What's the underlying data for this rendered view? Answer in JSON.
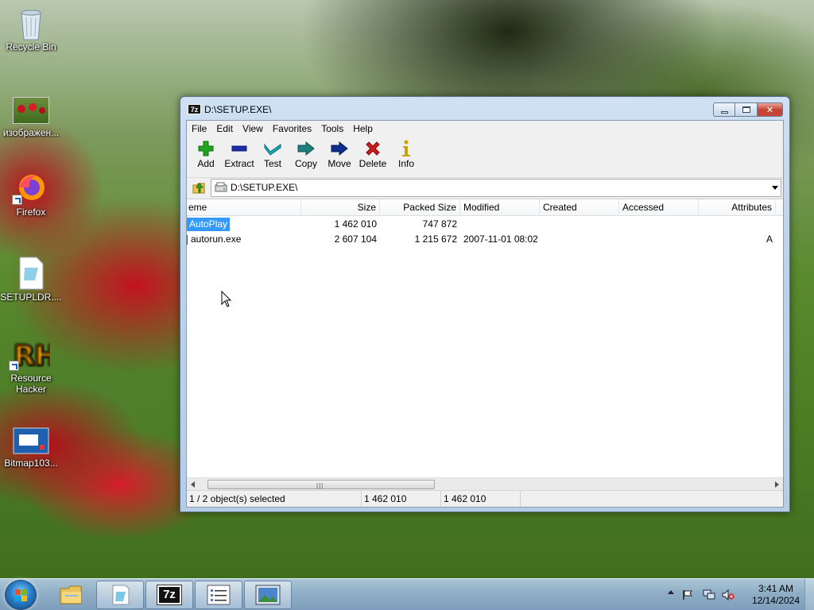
{
  "desktop": {
    "icons": [
      {
        "label": "Recycle Bin"
      },
      {
        "label": "изображен..."
      },
      {
        "label": "Firefox"
      },
      {
        "label": "SETUPLDR...."
      },
      {
        "label": "Resource Hacker"
      },
      {
        "label": "Bitmap103..."
      }
    ]
  },
  "window": {
    "app_icon_text": "7z",
    "title": "D:\\SETUP.EXE\\",
    "menu": [
      "File",
      "Edit",
      "View",
      "Favorites",
      "Tools",
      "Help"
    ],
    "toolbar": [
      {
        "label": "Add",
        "icon": "plus-icon",
        "color": "#1fa51f"
      },
      {
        "label": "Extract",
        "icon": "minus-icon",
        "color": "#1c2fa8"
      },
      {
        "label": "Test",
        "icon": "check-icon",
        "color": "#1aa7b3"
      },
      {
        "label": "Copy",
        "icon": "double-arrow-icon",
        "color": "#1f7f7f"
      },
      {
        "label": "Move",
        "icon": "arrow-right-icon",
        "color": "#0e2e8c"
      },
      {
        "label": "Delete",
        "icon": "x-icon",
        "color": "#d11b1b"
      },
      {
        "label": "Info",
        "icon": "info-icon",
        "color": "#c9a200"
      }
    ],
    "address": "D:\\SETUP.EXE\\",
    "columns": {
      "name": "eme",
      "size": "Size",
      "packed_size": "Packed Size",
      "modified": "Modified",
      "created": "Created",
      "accessed": "Accessed",
      "attributes": "Attributes"
    },
    "rows": [
      {
        "name": "AutoPlay",
        "size": "1 462 010",
        "packed_size": "747 872",
        "modified": "",
        "created": "",
        "accessed": "",
        "attributes": "",
        "selected": true,
        "is_folder": true
      },
      {
        "name": "autorun.exe",
        "size": "2 607 104",
        "packed_size": "1 215 672",
        "modified": "2007-11-01 08:02",
        "created": "",
        "accessed": "",
        "attributes": "A",
        "selected": false,
        "is_folder": false
      }
    ],
    "status": {
      "selection": "1 / 2 object(s) selected",
      "size": "1 462 010",
      "packed": "1 462 010"
    }
  },
  "taskbar": {
    "pinned": [
      {
        "name": "explorer",
        "icon": "folder-icon"
      },
      {
        "name": "setupldr",
        "icon": "disk-icon"
      },
      {
        "name": "7zip",
        "icon": "7z-icon",
        "text": "7z"
      },
      {
        "name": "notepad",
        "icon": "list-icon"
      },
      {
        "name": "image-viewer",
        "icon": "picture-icon"
      }
    ],
    "clock_time": "3:41 AM",
    "clock_date": "12/14/2024"
  }
}
